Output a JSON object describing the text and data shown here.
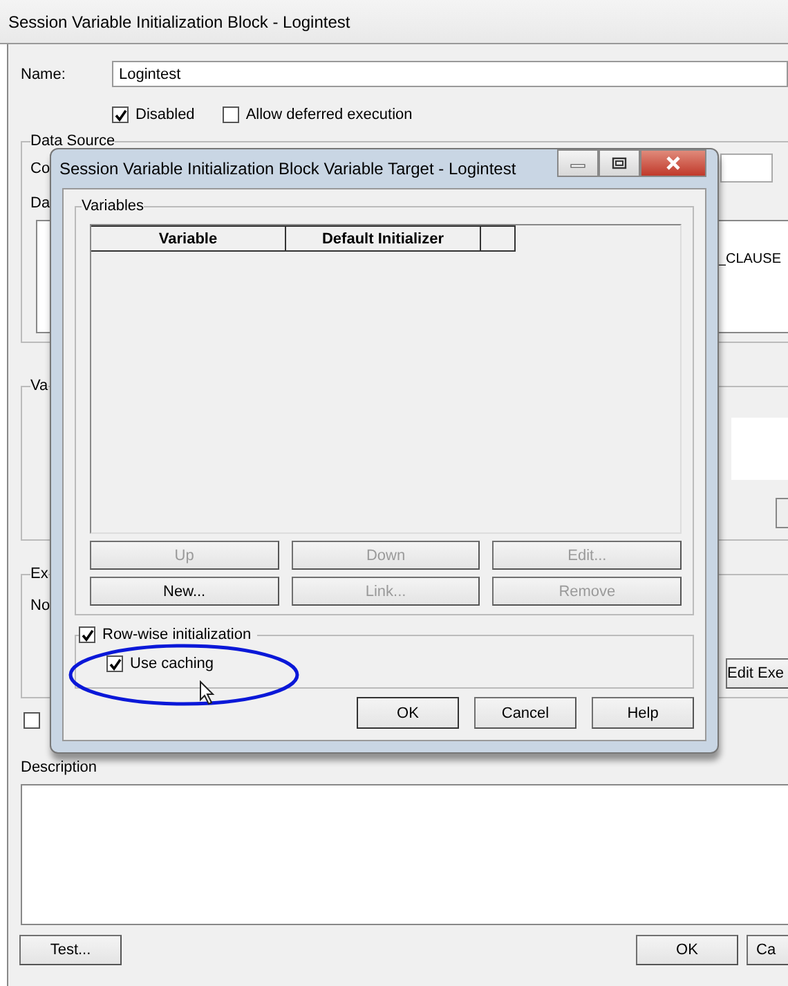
{
  "window": {
    "title": "Session Variable Initialization Block - Logintest"
  },
  "name": {
    "label": "Name:",
    "value": "Logintest"
  },
  "options": [
    {
      "label": "Disabled",
      "checked": true
    },
    {
      "label": "Allow deferred execution",
      "checked": false
    }
  ],
  "data_source": {
    "label": "Data Source",
    "fragments": [
      "Co",
      "Da"
    ],
    "sql_fragment": "_CLAUSE"
  },
  "variables_fragment": "Va",
  "execution": {
    "fragments": [
      "Ex",
      "No"
    ],
    "button": "Edit Exe"
  },
  "lower_checkbox": {
    "checked": false
  },
  "description": {
    "label": "Description"
  },
  "buttons": [
    {
      "label": "Test..."
    },
    {
      "label": "OK"
    },
    {
      "label": "Ca"
    }
  ],
  "dialog": {
    "title": "Session Variable Initialization Block Variable Target - Logintest",
    "group": "Variables",
    "columns": [
      "Variable",
      "Default Initializer",
      ""
    ],
    "button_rows": [
      [
        {
          "label": "Up",
          "disabled": true
        },
        {
          "label": "Down",
          "disabled": true
        },
        {
          "label": "Edit...",
          "disabled": true
        }
      ],
      [
        {
          "label": "New...",
          "disabled": false
        },
        {
          "label": "Link...",
          "disabled": true
        },
        {
          "label": "Remove",
          "disabled": true
        }
      ]
    ],
    "row_wise": {
      "label": "Row-wise initialization",
      "checked": true
    },
    "use_caching": {
      "label": "Use caching",
      "checked": true
    },
    "footer": [
      "OK",
      "Cancel",
      "Help"
    ]
  }
}
